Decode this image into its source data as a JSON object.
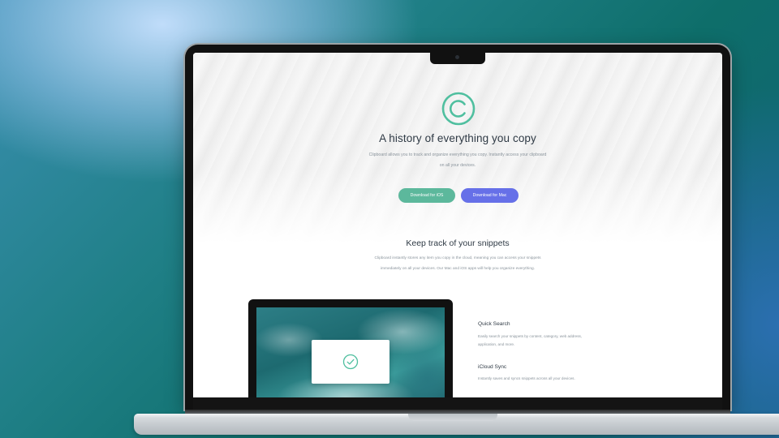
{
  "hero": {
    "title": "A history of everything you copy",
    "subtitle": "Clipboard allows you to track and organize everything you copy. Instantly access your clipboard on all your devices.",
    "ios_button": "Download for iOS",
    "mac_button": "Download for Mac"
  },
  "snippets": {
    "title": "Keep track of your snippets",
    "text": "Clipboard instantly stores any item you copy in the cloud, meaning you can access your snippets immediately on all your devices. Our Mac and iOS apps will help you organize everything."
  },
  "features": [
    {
      "title": "Quick Search",
      "text": "Easily search your snippets by content, category, web address, application, and more."
    },
    {
      "title": "iCloud Sync",
      "text": "Instantly saves and syncs snippets across all your devices."
    }
  ],
  "colors": {
    "brand_teal": "#4fbf9f",
    "ios_button": "#5cb89c",
    "mac_button": "#6670e8",
    "heading": "#2f3a45",
    "body_text": "#8a949c"
  },
  "icons": {
    "logo": "copyright-circle-icon",
    "check": "check-circle-icon",
    "camera": "camera-icon"
  }
}
